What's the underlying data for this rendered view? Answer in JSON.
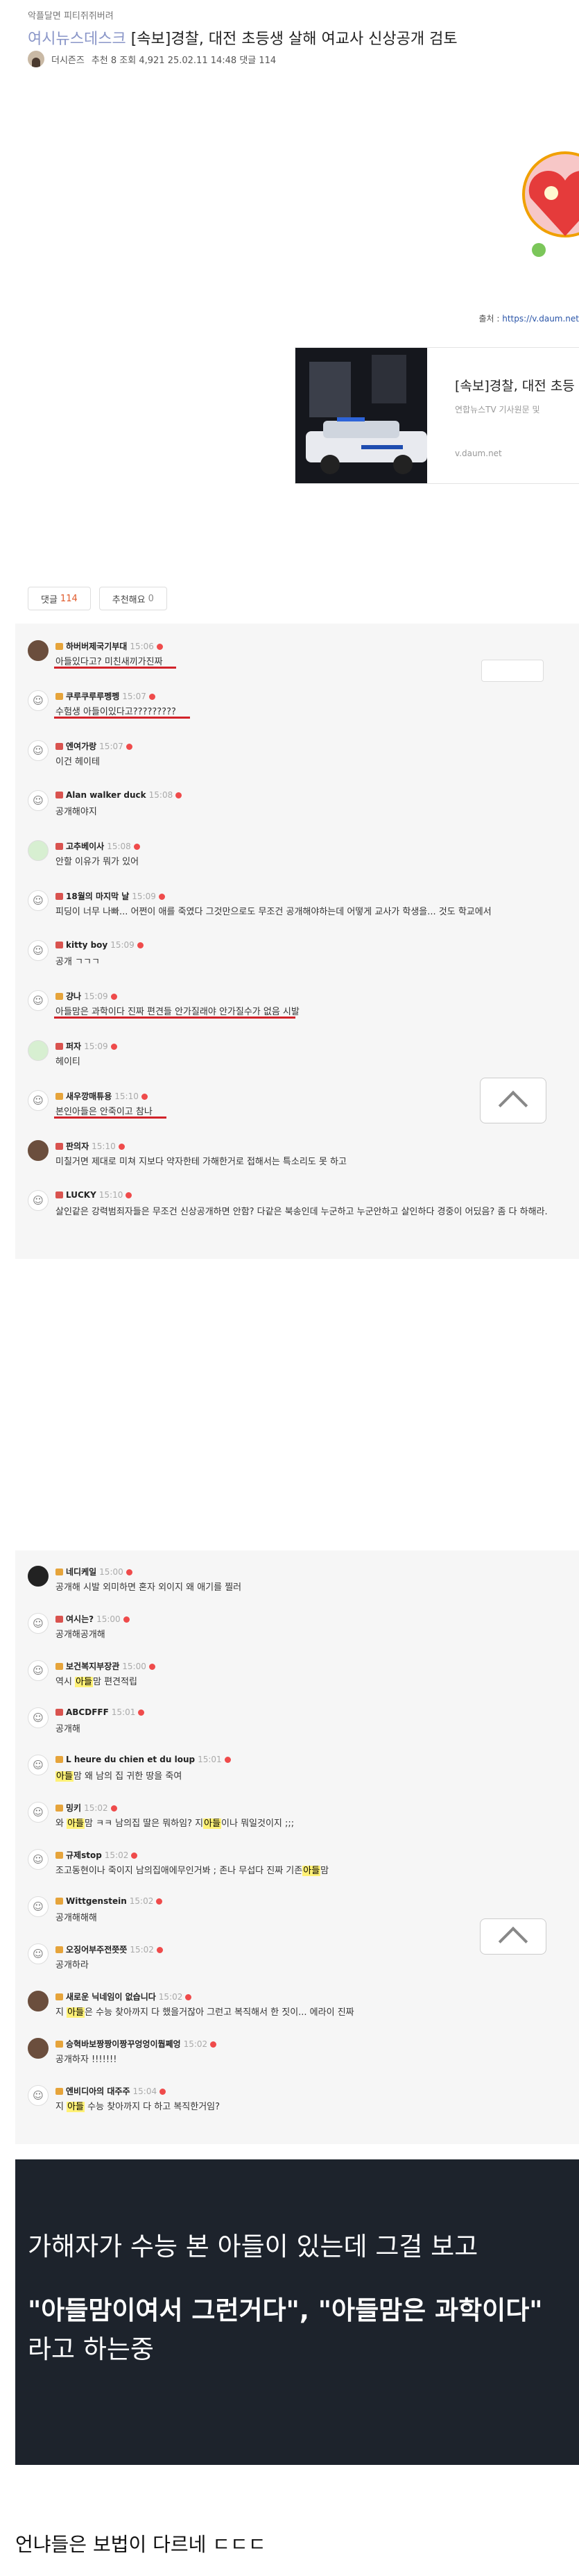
{
  "breadcrumb": "악플달면 피티쥐쥐버려",
  "post": {
    "board": "여시뉴스데스크",
    "title": "[속보]경찰, 대전 초등생 살해 여교사 신상공개 검토",
    "author": "더시즌즈",
    "stats": "추천 8   조회 4,921   25.02.11 14:48   댓글 114"
  },
  "source": {
    "label": "출처 :",
    "link": "https://v.daum.net"
  },
  "link_card": {
    "title": "[속보]경찰, 대전 초등",
    "subtitle": "연합뉴스TV 기사원문 및",
    "url": "v.daum.net"
  },
  "tabs": {
    "comments_label": "댓글",
    "comments_count": "114",
    "recommend_label": "추천해요",
    "recommend_count": "0"
  },
  "comments_a": [
    {
      "nick": "하버버제국기부대",
      "time": "15:06",
      "text": "아들있다고? 미친새끼가진짜",
      "avatar": "photo"
    },
    {
      "nick": "쿠루쿠루루펭펭",
      "time": "15:07",
      "text": "수험생 아들이있다고?????????",
      "avatar": "ghost"
    },
    {
      "nick": "엔여가랑",
      "time": "15:07",
      "text": "이건 헤이테",
      "avatar": "ghost"
    },
    {
      "nick": "Alan walker duck",
      "time": "15:08",
      "text": "공개해야지",
      "avatar": "ghost"
    },
    {
      "nick": "고추베이사",
      "time": "15:08",
      "text": "안할 이유가 뭐가 있어",
      "avatar": "green"
    },
    {
      "nick": "18월의 마지막 날",
      "time": "15:09",
      "text": "피딩이 너무 나빠... 어쩐이 애를 죽였다 그것만으로도 무조건 공개해야하는데 어떻게 교사가 학생을... 것도 학교에서",
      "avatar": "ghost"
    },
    {
      "nick": "kitty boy",
      "time": "15:09",
      "text": "공개 ㄱㄱㄱ",
      "avatar": "ghost"
    },
    {
      "nick": "걍나",
      "time": "15:09",
      "text": "아들맘은 과학이다 진짜 편견들 안가질래야 안가질수가 없음 시발",
      "avatar": "ghost"
    },
    {
      "nick": "퍼자",
      "time": "15:09",
      "text": "헤이티",
      "avatar": "green"
    },
    {
      "nick": "새우깡매튜용",
      "time": "15:10",
      "text": "본인아들은 안죽이고 참나",
      "avatar": "ghost"
    },
    {
      "nick": "판의자",
      "time": "15:10",
      "text": "미칠거면 제대로 미쳐 지보다 약자한테 가해한거로 접해서는 특소리도 못 하고",
      "avatar": "photo"
    },
    {
      "nick": "LUCKY",
      "time": "15:10",
      "text": "살인같은 강력범죄자들은 무조건 신상공개하면 안함? 다같은 북송인데 누군하고 누군안하고 살인하다 경중이 어딨음? 좀 다 하해라.",
      "avatar": "ghost"
    }
  ],
  "comments_b": [
    {
      "nick": "네디케일",
      "time": "15:00",
      "text": "공개해 시발 외미하면 혼자 외이지 왜 애기를 찔러",
      "avatar": "dark"
    },
    {
      "nick": "여시는?",
      "time": "15:00",
      "text": "공개해공개해",
      "avatar": "ghost"
    },
    {
      "nick": "보건복지부장관",
      "time": "15:00",
      "text": "역시 아들맘 편견적립",
      "hl": "아들",
      "avatar": "ghost"
    },
    {
      "nick": "ABCDFFF",
      "time": "15:01",
      "text": "공개해",
      "avatar": "ghost"
    },
    {
      "nick": "L heure du chien et du loup",
      "time": "15:01",
      "text": "아들맘 왜 남의 집 귀한 땅을 죽여",
      "hl": "아들",
      "avatar": "ghost"
    },
    {
      "nick": "밍키",
      "time": "15:02",
      "text": "와 아들맘 ㅋㅋ 남의집 딸은 뭐하임? 지아들이나 뭐일것이지 ;;;",
      "hl": "아들",
      "avatar": "ghost"
    },
    {
      "nick": "규제stop",
      "time": "15:02",
      "text": "조고동현이나 죽이지 남의집애에무인거봐 ; 존나 무섭다 진짜 기존아들맘",
      "hl": "아들",
      "avatar": "ghost"
    },
    {
      "nick": "Wittgenstein",
      "time": "15:02",
      "text": "공개해해해",
      "avatar": "ghost"
    },
    {
      "nick": "오징어부주전쯧쯧",
      "time": "15:02",
      "text": "공개하라",
      "avatar": "ghost"
    },
    {
      "nick": "새로운 닉네임이 없습니다",
      "time": "15:02",
      "text": "지 아들은 수능 찾아까지 다 했을거잖아 그런고 복직해서 한 짓이... 에라이 진짜",
      "hl": "아들",
      "avatar": "photo"
    },
    {
      "nick": "승혁바보짱짱이짱꾸엉엉이뭡쩨엉",
      "time": "15:02",
      "text": "공개하자 !!!!!!!",
      "avatar": "photo"
    },
    {
      "nick": "엔비디아의 대주주",
      "time": "15:04",
      "text": "지 아들 수능 찾아까지 다 하고 복직한거임?",
      "hl": "아들",
      "avatar": "ghost"
    }
  ],
  "dark_panel": {
    "line1": "가해자가 수능 본 아들이 있는데 그걸 보고",
    "line2_bold": "\"아들맘이여서 그런거다\", \"아들맘은 과학이다\"",
    "line2_rest": " 라고 하는중"
  },
  "footer": "언냐들은 보법이 다르네 ㄷㄷㄷ"
}
